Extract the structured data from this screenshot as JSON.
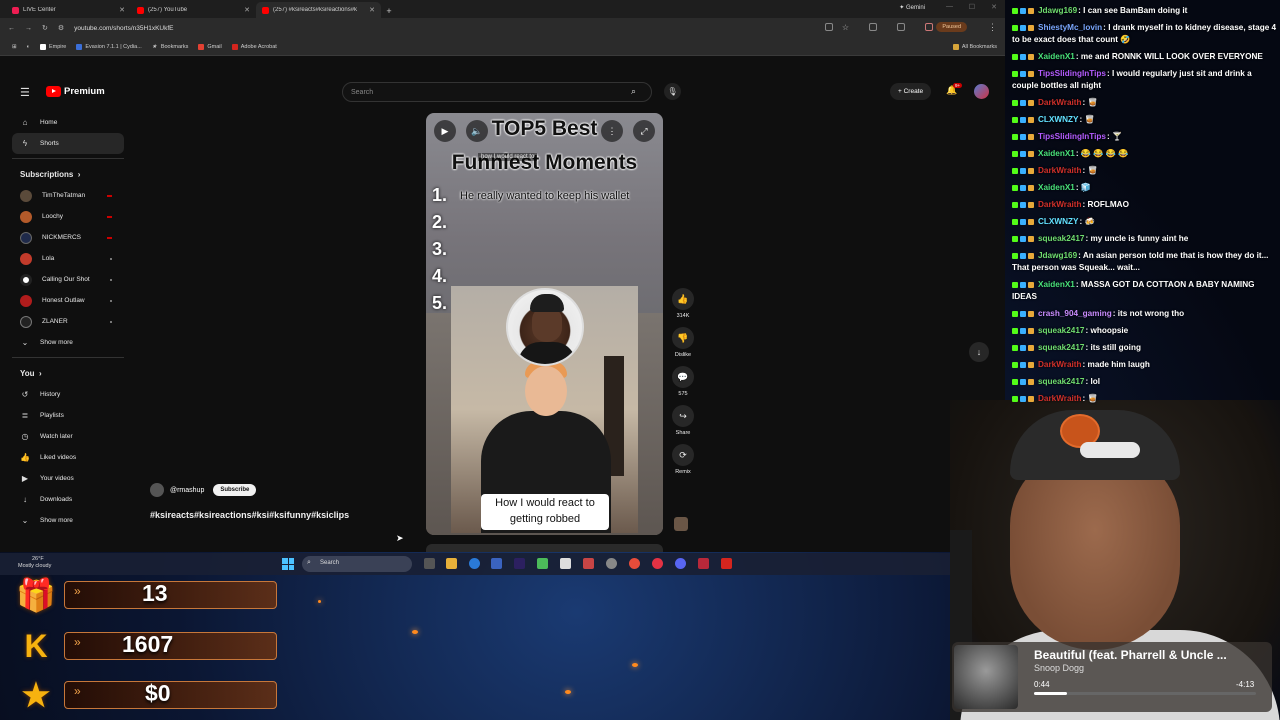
{
  "browser": {
    "tabs": [
      {
        "label": "LIVE Center",
        "color": "#ee1d52"
      },
      {
        "label": "(257) YouTube",
        "color": "#ff0000"
      },
      {
        "label": "(257) #ksireacts#ksireactions#k",
        "color": "#ff0000"
      }
    ],
    "gemini": "Gemini",
    "url": "youtube.com/shorts/n35H1xKUkfE",
    "paused": "Paused",
    "bookmarks": [
      "Empire",
      "Evasion 7.1.1 | Cydia...",
      "Bookmarks",
      "Gmail",
      "Adobe Acrobat"
    ],
    "all_bookmarks": "All Bookmarks"
  },
  "youtube": {
    "logo": "Premium",
    "search_placeholder": "Search",
    "create": "Create",
    "notif_count": "9+",
    "sidebar": {
      "main": [
        {
          "label": "Home",
          "icon": "⌂"
        },
        {
          "label": "Shorts",
          "icon": "ϟ"
        }
      ],
      "subscriptions_heading": "Subscriptions",
      "subscriptions": [
        {
          "label": "TimTheTatman",
          "color": "#5a4a3a",
          "live": true
        },
        {
          "label": "Loochy",
          "color": "#b35a2a",
          "live": true
        },
        {
          "label": "NICKMERCS",
          "color": "#1f2a4a",
          "live": true
        },
        {
          "label": "Lola",
          "color": "#c23b2b",
          "live": false
        },
        {
          "label": "Calling Our Shot",
          "color": "#ffffff",
          "live": false
        },
        {
          "label": "Honest Outlaw",
          "color": "#b01c1c",
          "live": false
        },
        {
          "label": "ZLANER",
          "color": "#222222",
          "live": false
        }
      ],
      "show_more": "Show more",
      "you_heading": "You",
      "you": [
        {
          "label": "History",
          "icon": "↺"
        },
        {
          "label": "Playlists",
          "icon": "≣"
        },
        {
          "label": "Watch later",
          "icon": "◷"
        },
        {
          "label": "Liked videos",
          "icon": "👍"
        },
        {
          "label": "Your videos",
          "icon": "▶"
        },
        {
          "label": "Downloads",
          "icon": "↓"
        }
      ],
      "show_more_2": "Show more"
    },
    "short": {
      "title_top": "TOP5 Best",
      "title_main": "Funniest Moments",
      "overlay_text": "how I would react to",
      "ranks": [
        "1.",
        "2.",
        "3.",
        "4.",
        "5."
      ],
      "caption1": "He really wanted to keep his wallet",
      "caption2": "How I would react to getting robbed",
      "channel": "@rmashup",
      "subscribe": "Subscribe",
      "tags": "#ksireacts#ksireactions#ksi#ksifunny#ksiclips"
    },
    "actions": [
      {
        "icon": "👍",
        "label": "314K",
        "name": "like"
      },
      {
        "icon": "👎",
        "label": "Dislike",
        "name": "dislike"
      },
      {
        "icon": "💬",
        "label": "575",
        "name": "comments"
      },
      {
        "icon": "↪",
        "label": "Share",
        "name": "share"
      },
      {
        "icon": "⟳",
        "label": "Remix",
        "name": "remix"
      }
    ]
  },
  "taskbar": {
    "temp": "26°F",
    "weather": "Mostly cloudy",
    "search": "Search"
  },
  "stats": [
    {
      "icon": "🎁",
      "value": "13",
      "name": "gifts"
    },
    {
      "icon": "K",
      "value": "1607",
      "name": "kicks"
    },
    {
      "icon": "★",
      "value": "$0",
      "name": "dollars"
    }
  ],
  "chat": [
    {
      "user": "Jdawg169",
      "color": "#6fdc6f",
      "text": "I can see BamBam doing it"
    },
    {
      "user": "ShiestyMc_lovin",
      "color": "#7aa7ff",
      "text": "I drank myself in to kidney disease, stage 4 to be exact does that count 🤣"
    },
    {
      "user": "XaidenX1",
      "color": "#49e07a",
      "text": "me and RONNK WILL LOOK OVER EVERYONE"
    },
    {
      "user": "TipsSlidingInTips",
      "color": "#b45cff",
      "text": "I would regularly just sit and drink a couple bottles all night"
    },
    {
      "user": "DarkWraith",
      "color": "#d0302a",
      "text": "🥃"
    },
    {
      "user": "CLXWNZY",
      "color": "#62e0ff",
      "text": "🥃"
    },
    {
      "user": "TipsSlidingInTips",
      "color": "#b45cff",
      "text": "🍸"
    },
    {
      "user": "XaidenX1",
      "color": "#49e07a",
      "text": "😂 😂 😂 😂"
    },
    {
      "user": "DarkWraith",
      "color": "#d0302a",
      "text": "🥃"
    },
    {
      "user": "XaidenX1",
      "color": "#49e07a",
      "text": "🧊"
    },
    {
      "user": "DarkWraith",
      "color": "#d0302a",
      "text": "ROFLMAO"
    },
    {
      "user": "CLXWNZY",
      "color": "#62e0ff",
      "text": "🍻"
    },
    {
      "user": "squeak2417",
      "color": "#6fdc6f",
      "text": "my uncle is funny aint he"
    },
    {
      "user": "Jdawg169",
      "color": "#6fdc6f",
      "text": "An asian person told me that is how they do it... That person was Squeak... wait..."
    },
    {
      "user": "XaidenX1",
      "color": "#49e07a",
      "text": "MASSA GOT DA COTTAON A BABY NAMING IDEAS"
    },
    {
      "user": "crash_904_gaming",
      "color": "#c98cff",
      "text": "its not wrong tho"
    },
    {
      "user": "squeak2417",
      "color": "#6fdc6f",
      "text": "whoopsie"
    },
    {
      "user": "squeak2417",
      "color": "#6fdc6f",
      "text": "its still going"
    },
    {
      "user": "DarkWraith",
      "color": "#d0302a",
      "text": "made him laugh"
    },
    {
      "user": "squeak2417",
      "color": "#6fdc6f",
      "text": "lol"
    },
    {
      "user": "DarkWraith",
      "color": "#d0302a",
      "text": "🥃"
    }
  ],
  "now_playing": {
    "title": "Beautiful (feat. Pharrell & Uncle ...",
    "artist": "Snoop Dogg",
    "elapsed": "0:44",
    "remaining": "-4:13",
    "progress": 0.15
  }
}
